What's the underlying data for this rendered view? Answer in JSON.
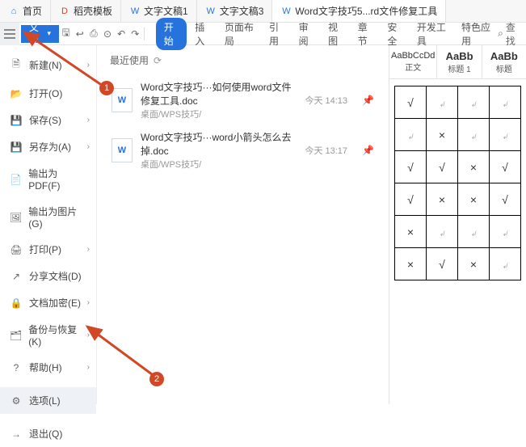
{
  "tabs": [
    {
      "label": "首页",
      "icon": "⌂",
      "cls": "wps-blue"
    },
    {
      "label": "稻壳模板",
      "icon": "D",
      "cls": "wps-orange"
    },
    {
      "label": "文字文稿1",
      "icon": "W",
      "cls": "wps-blue"
    },
    {
      "label": "文字文稿3",
      "icon": "W",
      "cls": "wps-blue"
    },
    {
      "label": "Word文字技巧5...rd文件修复工具",
      "icon": "W",
      "cls": "wps-blue"
    }
  ],
  "file_btn": "文件",
  "menu_tabs": [
    "开始",
    "插入",
    "页面布局",
    "引用",
    "审阅",
    "视图",
    "章节",
    "安全",
    "开发工具",
    "特色应用"
  ],
  "search": "查找",
  "leftmenu": [
    {
      "label": "新建(N)",
      "icon": "🗎",
      "chev": true
    },
    {
      "label": "打开(O)",
      "icon": "📂"
    },
    {
      "label": "保存(S)",
      "icon": "💾",
      "chev": true
    },
    {
      "label": "另存为(A)",
      "icon": "💾",
      "chev": true
    },
    {
      "label": "输出为PDF(F)",
      "icon": "📄"
    },
    {
      "label": "输出为图片(G)",
      "icon": "🖼"
    },
    {
      "label": "打印(P)",
      "icon": "🖨",
      "chev": true
    },
    {
      "label": "分享文档(D)",
      "icon": "↗"
    },
    {
      "label": "文档加密(E)",
      "icon": "🔒",
      "chev": true
    },
    {
      "label": "备份与恢复(K)",
      "icon": "🗂",
      "chev": true
    },
    {
      "label": "帮助(H)",
      "icon": "?",
      "chev": true
    },
    {
      "label": "选项(L)",
      "icon": "⚙",
      "sel": true
    },
    {
      "label": "退出(Q)",
      "icon": "→"
    }
  ],
  "recent_label": "最近使用",
  "docs": [
    {
      "title": "Word文字技巧···如何使用word文件修复工具.doc",
      "sub": "桌面/WPS技巧/",
      "time": "今天 14:13"
    },
    {
      "title": "Word文字技巧···word小箭头怎么去掉.doc",
      "sub": "桌面/WPS技巧/",
      "time": "今天 13:17"
    }
  ],
  "styles": [
    {
      "prev": "AaBbCcDd",
      "name": "正文",
      "bold": false
    },
    {
      "prev": "AaBb",
      "name": "标题 1",
      "bold": true
    },
    {
      "prev": "AaBb",
      "name": "标题 ",
      "bold": true
    }
  ],
  "cells": [
    [
      "√",
      "",
      "",
      ""
    ],
    [
      "",
      "×",
      "",
      ""
    ],
    [
      "√",
      "√",
      "×",
      "√"
    ],
    [
      "√",
      "×",
      "×",
      "√"
    ],
    [
      "×",
      "",
      "",
      ""
    ],
    [
      "×",
      "√",
      "×",
      ""
    ]
  ],
  "badges": {
    "b1": "1",
    "b2": "2"
  }
}
